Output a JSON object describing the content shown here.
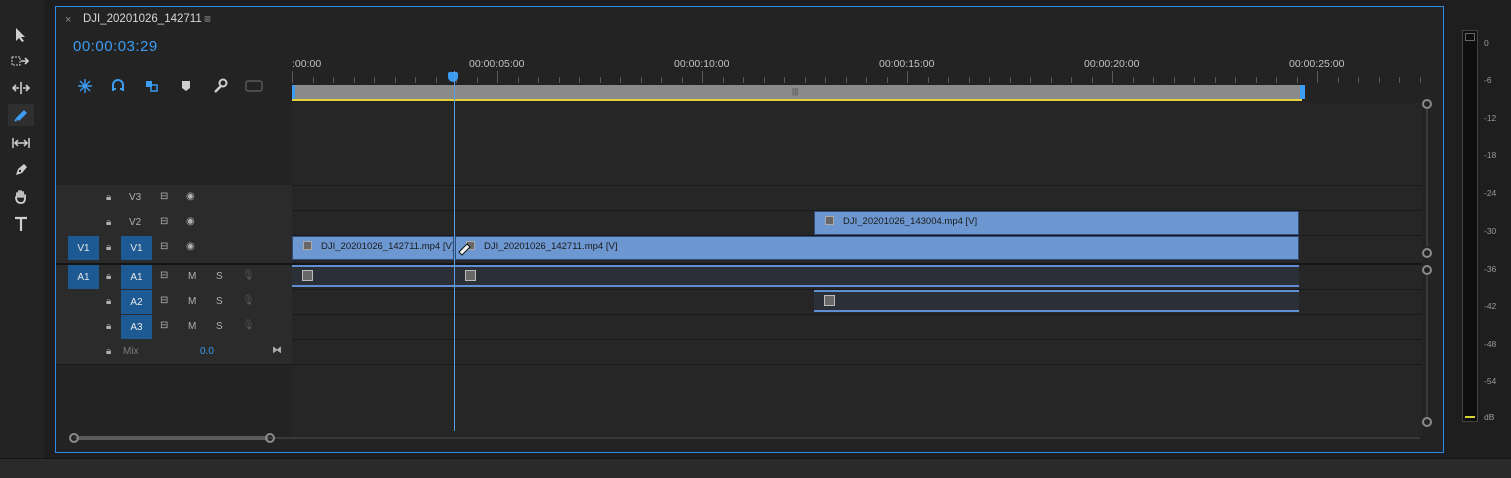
{
  "sequence": {
    "tab_title": "DJI_20201026_142711",
    "close_glyph": "×",
    "menu_glyph": "≡",
    "timecode": "00:00:03:29"
  },
  "ruler": {
    "labels": [
      ":00:00",
      "00:00:05:00",
      "00:00:10:00",
      "00:00:15:00",
      "00:00:20:00",
      "00:00:25:00"
    ]
  },
  "tracks": {
    "video": [
      {
        "name": "V3",
        "target": ""
      },
      {
        "name": "V2",
        "target": ""
      },
      {
        "name": "V1",
        "target": "V1"
      }
    ],
    "audio": [
      {
        "name": "A1",
        "target": "A1",
        "m": "M",
        "s": "S"
      },
      {
        "name": "A2",
        "target": "",
        "m": "M",
        "s": "S"
      },
      {
        "name": "A3",
        "target": "",
        "m": "M",
        "s": "S"
      }
    ],
    "mix": {
      "label": "Mix",
      "value": "0.0"
    }
  },
  "clips": {
    "v1_a": "DJI_20201026_142711.mp4 [V]",
    "v1_b": "DJI_20201026_142711.mp4 [V]",
    "v2": "DJI_20201026_143004.mp4 [V]"
  },
  "meter": {
    "labels": [
      "0",
      "-6",
      "-12",
      "-18",
      "-24",
      "-30",
      "-36",
      "-42",
      "-48",
      "-54",
      "dB"
    ]
  },
  "colors": {
    "accent": "#2d8ceb",
    "clip_video": "#6d97d1",
    "target_badge": "#1d5a94",
    "timecode": "#3b9cf2"
  }
}
